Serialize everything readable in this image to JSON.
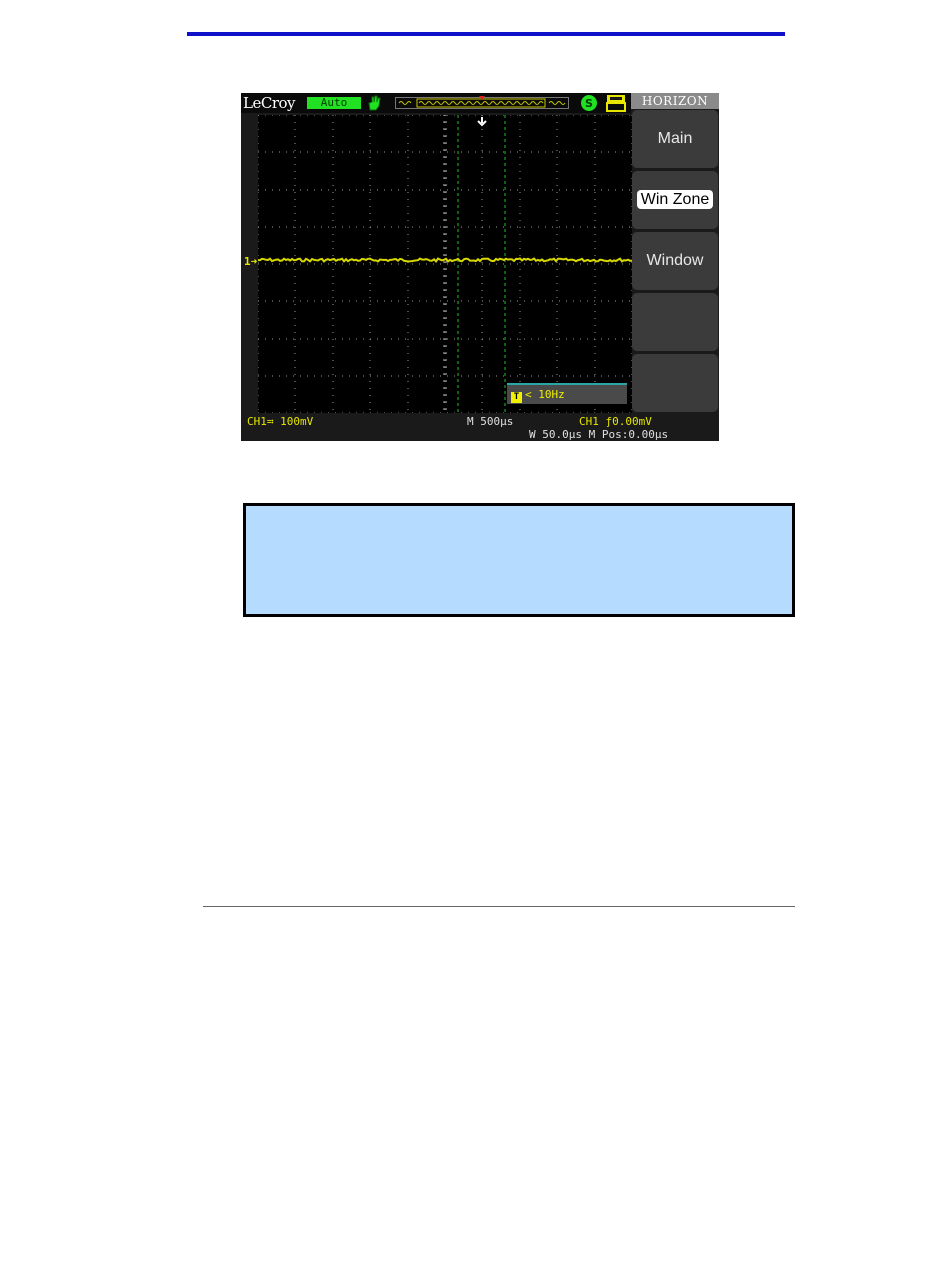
{
  "colors": {
    "rule": "#1010c8",
    "trace": "#e6e600",
    "note_fill": "#b5dcff",
    "cursor_lines": "#22c022"
  },
  "scope": {
    "brand": "LeCroy",
    "trigger_mode": "Auto",
    "icons": [
      "hand-icon",
      "memory-bar-icon",
      "trigger-status-icon",
      "usb-icon"
    ],
    "menu_title": "HORIZON",
    "softkeys": [
      {
        "label": "Main",
        "selected": false
      },
      {
        "label": "Win Zone",
        "selected": true
      },
      {
        "label": "Window",
        "selected": false
      },
      {
        "label": "",
        "selected": false
      },
      {
        "label": "",
        "selected": false
      }
    ],
    "channel_marker": "1",
    "frequency_readout": "< 10Hz",
    "status": {
      "channel_scale": "CH1≕ 100mV",
      "timebase": "M 500μs",
      "trigger": "CH1 ƒ0.00mV",
      "window": "W 50.0μs M Pos:0.00μs"
    }
  }
}
